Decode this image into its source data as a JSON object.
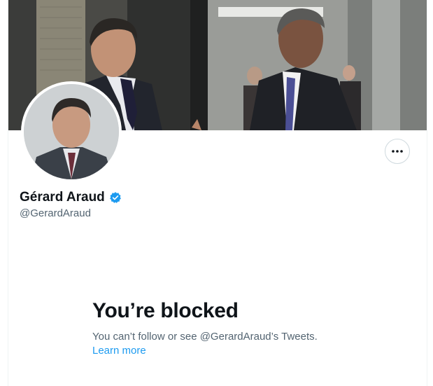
{
  "profile": {
    "display_name": "Gérard Araud",
    "handle": "@GerardAraud",
    "verified": true,
    "banner_image": "banner-photo",
    "avatar_image": "profile-photo"
  },
  "actions": {
    "more_icon": "more-horizontal-icon"
  },
  "blocked": {
    "title": "You’re blocked",
    "description": "You can’t follow or see @GerardAraud’s Tweets.",
    "learn_more": "Learn more"
  },
  "colors": {
    "text_primary": "#0f1419",
    "text_secondary": "#536471",
    "accent": "#1d9bf0",
    "border": "#cfd9de"
  }
}
